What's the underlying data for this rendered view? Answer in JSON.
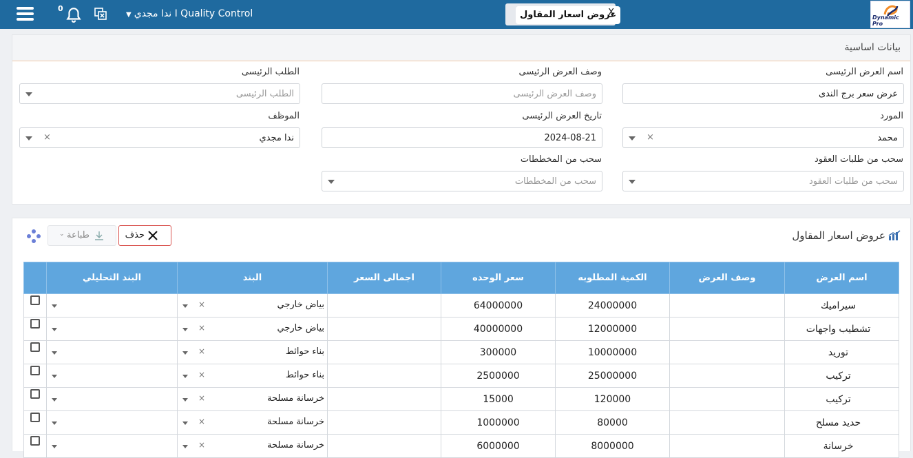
{
  "topbar": {
    "notification_count": "0",
    "user_label": "ندا مجدي I Quality Control",
    "page_tab": "عروض اسعار المقاول",
    "tab_close": "X",
    "logo_text": "Dynamic Pro"
  },
  "basic": {
    "title": "بيانات اساسية",
    "fields": {
      "offer_name": {
        "label": "اسم العرض الرئيسى",
        "value": "عرض سعر برج الندى"
      },
      "offer_desc": {
        "label": "وصف العرض الرئيسى",
        "placeholder": "وصف العرض الرئيسى"
      },
      "main_request": {
        "label": "الطلب الرئيسى",
        "placeholder": "الطلب الرئيسى"
      },
      "supplier": {
        "label": "المورد",
        "value": "محمد"
      },
      "offer_date": {
        "label": "تاريخ العرض الرئيسى",
        "value": "2024-08-21"
      },
      "employee": {
        "label": "الموظف",
        "value": "ندا مجدي"
      },
      "contract_requests": {
        "label": "سحب من طلبات العقود",
        "placeholder": "سحب من طلبات العقود"
      },
      "plans": {
        "label": "سحب من المخططات",
        "placeholder": "سحب من المخططات"
      }
    }
  },
  "offers": {
    "title": "عروض اسعار المقاول",
    "delete_label": "حذف",
    "print_label": "طباعة",
    "columns": [
      "اسم العرض",
      "وصف العرض",
      "الكمية المطلوبه",
      "سعر الوحده",
      "اجمالى السعر",
      "البند",
      "البند التحليلي"
    ],
    "rows": [
      {
        "name": "سيراميك",
        "desc": "",
        "qty": "24000000",
        "unit_price": "64000000",
        "total": "",
        "item": "بياض خارجي"
      },
      {
        "name": "تشطيب واجهات",
        "desc": "",
        "qty": "12000000",
        "unit_price": "40000000",
        "total": "",
        "item": "بياض خارجي"
      },
      {
        "name": "توريد",
        "desc": "",
        "qty": "10000000",
        "unit_price": "300000",
        "total": "",
        "item": "بناء حوائط"
      },
      {
        "name": "تركيب",
        "desc": "",
        "qty": "25000000",
        "unit_price": "2500000",
        "total": "",
        "item": "بناء حوائط"
      },
      {
        "name": "تركيب",
        "desc": "",
        "qty": "120000",
        "unit_price": "15000",
        "total": "",
        "item": "خرسانة مسلحة"
      },
      {
        "name": "حديد مسلح",
        "desc": "",
        "qty": "80000",
        "unit_price": "1000000",
        "total": "",
        "item": "خرسانة مسلحة"
      },
      {
        "name": "خرسانة",
        "desc": "",
        "qty": "8000000",
        "unit_price": "6000000",
        "total": "",
        "item": "خرسانة مسلحة"
      }
    ]
  },
  "colors": {
    "topbar": "#1f6a9f",
    "table_header": "#5fa6de",
    "delete_border": "#d9534f"
  }
}
